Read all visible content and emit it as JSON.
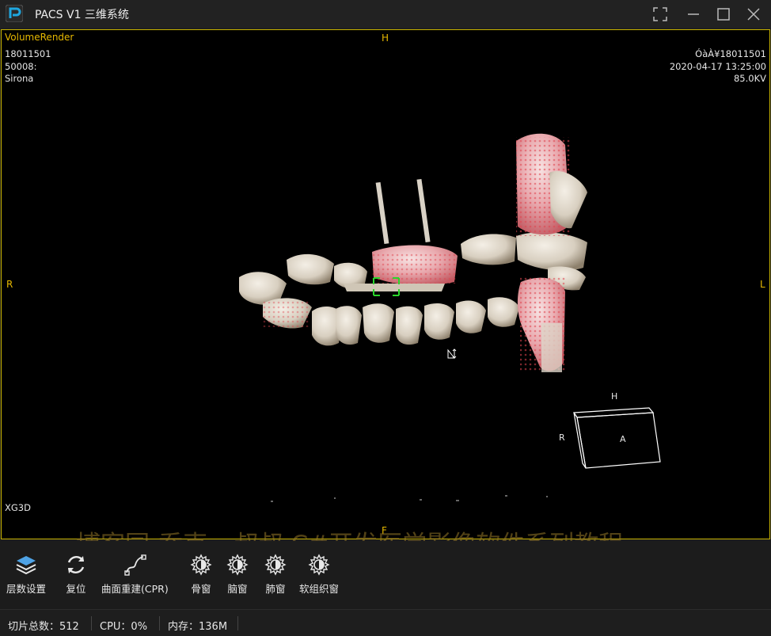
{
  "window": {
    "title": "PACS V1 三维系统",
    "logo_color": "#1ea7e0"
  },
  "viewport": {
    "mode_label": "VolumeRender",
    "orient_top": "H",
    "orient_left": "R",
    "orient_right": "L",
    "orient_bottom": "F",
    "patient_id": "18011501",
    "series": "50008:",
    "manufacturer": "Sirona",
    "patient_name": "ÓàÀ¥18011501",
    "datetime": "2020-04-17 13:25:00",
    "kv": "85.0KV",
    "bottom_left_label": "XG3D",
    "border_color": "#c9b400",
    "orient_cube": {
      "top": "H",
      "left": "R",
      "front": "A"
    }
  },
  "watermark": "博客园-乔克---叔叔 C#开发医学影像软件系列教程",
  "toolbar": {
    "items": [
      {
        "label": "层数设置",
        "icon": "layers-icon"
      },
      {
        "label": "复位",
        "icon": "reset-icon"
      },
      {
        "label": "曲面重建(CPR)",
        "icon": "curve-icon"
      },
      {
        "label": "骨窗",
        "icon": "window-icon"
      },
      {
        "label": "脑窗",
        "icon": "window-icon"
      },
      {
        "label": "肺窗",
        "icon": "window-icon"
      },
      {
        "label": "软组织窗",
        "icon": "window-icon"
      }
    ]
  },
  "status": {
    "slices": "切片总数：512",
    "cpu": "CPU：0%",
    "memory": "内存：136M"
  }
}
